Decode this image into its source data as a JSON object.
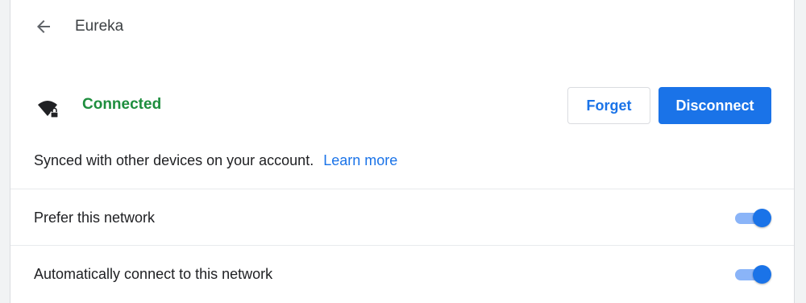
{
  "header": {
    "back_icon": "arrow-left-icon",
    "title": "Eureka"
  },
  "status": {
    "icon": "wifi-locked-icon",
    "text": "Connected",
    "color": "#1e8e3e"
  },
  "actions": {
    "forget_label": "Forget",
    "disconnect_label": "Disconnect",
    "accent": "#1a73e8"
  },
  "sync": {
    "text": "Synced with other devices on your account.",
    "link": "Learn more"
  },
  "settings": [
    {
      "label": "Prefer this network",
      "enabled": true
    },
    {
      "label": "Automatically connect to this network",
      "enabled": true
    }
  ]
}
